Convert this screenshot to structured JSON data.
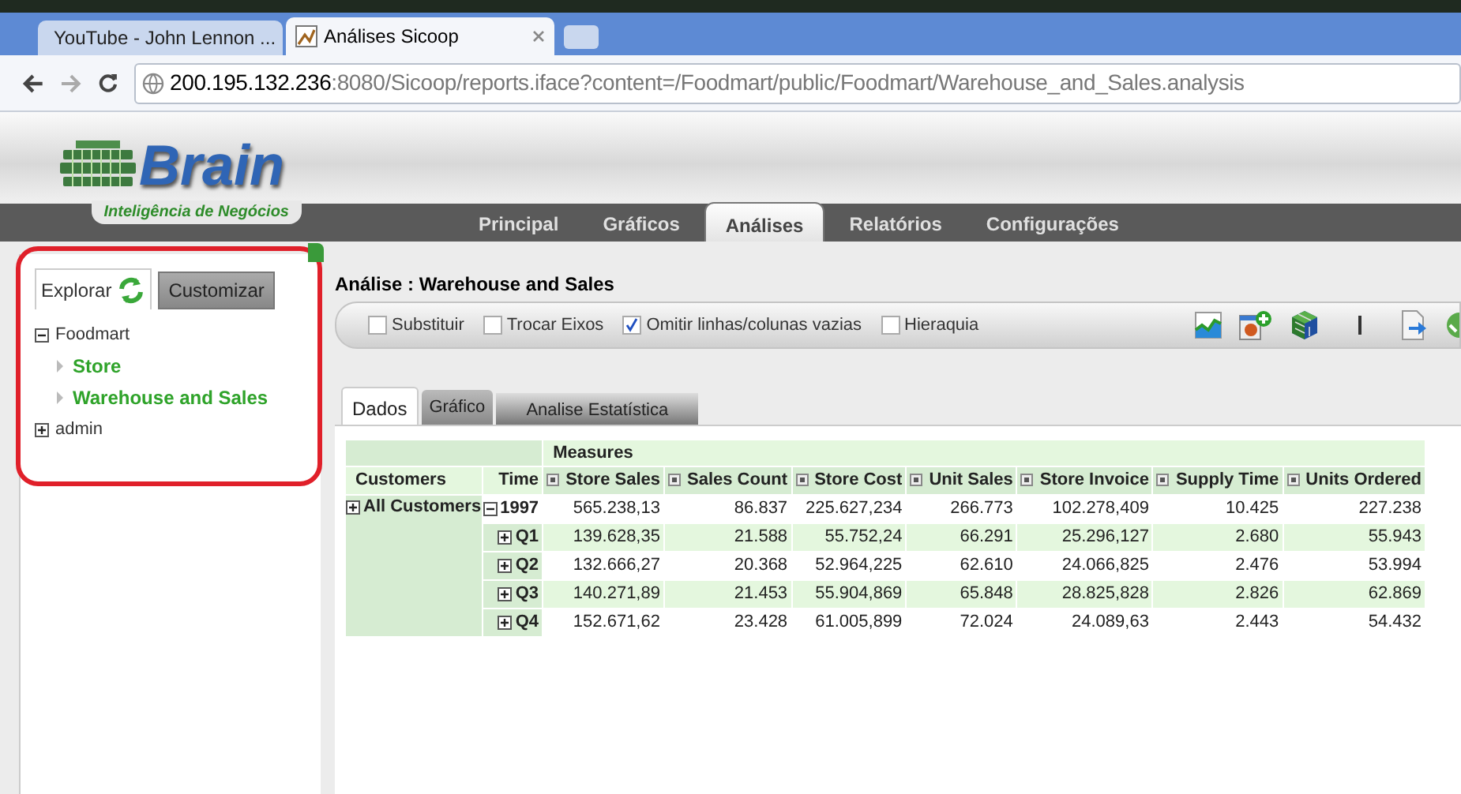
{
  "browser_tabs": [
    {
      "title": "YouTube - John Lennon ...",
      "selected": false,
      "kind": "video"
    },
    {
      "title": "Análises Sicoop",
      "selected": true,
      "kind": "app"
    }
  ],
  "address": {
    "host": "200.195.132.236",
    "rest": ":8080/Sicoop/reports.iface?content=/Foodmart/public/Foodmart/Warehouse_and_Sales.analysis"
  },
  "logo": {
    "name": "Brain",
    "tagline": "Inteligência de Negócios"
  },
  "nav_tabs": [
    {
      "label": "Principal",
      "selected": false
    },
    {
      "label": "Gráficos",
      "selected": false
    },
    {
      "label": "Análises",
      "selected": true
    },
    {
      "label": "Relatórios",
      "selected": false
    },
    {
      "label": "Configurações",
      "selected": false
    }
  ],
  "sidebar": {
    "tabs": [
      {
        "label": "Explorar",
        "selected": true
      },
      {
        "label": "Customizar",
        "selected": false
      }
    ],
    "tree": [
      {
        "label": "Foodmart",
        "expanded": true,
        "children": [
          {
            "label": "Store"
          },
          {
            "label": "Warehouse and Sales"
          }
        ]
      },
      {
        "label": "admin",
        "expanded": false
      }
    ]
  },
  "title": "Análise : Warehouse and Sales",
  "options": [
    {
      "label": "Substituir",
      "checked": false
    },
    {
      "label": "Trocar Eixos",
      "checked": false
    },
    {
      "label": "Omitir linhas/colunas vazias",
      "checked": true
    },
    {
      "label": "Hieraquia",
      "checked": false
    }
  ],
  "view_tabs": [
    {
      "label": "Dados",
      "selected": true
    },
    {
      "label": "Gráfico",
      "selected": false
    },
    {
      "label": "Analise Estatística",
      "selected": false
    }
  ],
  "table": {
    "measures_label": "Measures",
    "row_header": "Customers",
    "time_header": "Time",
    "columns": [
      "Store Sales",
      "Sales Count",
      "Store Cost",
      "Unit Sales",
      "Store Invoice",
      "Supply Time",
      "Units Ordered"
    ],
    "customer": {
      "label": "All Customers",
      "expanded": false
    },
    "rows": [
      {
        "time": "1997",
        "expanded": true,
        "values": [
          "565.238,13",
          "86.837",
          "225.627,234",
          "266.773",
          "102.278,409",
          "10.425",
          "227.238"
        ]
      },
      {
        "time": "Q1",
        "expanded": false,
        "values": [
          "139.628,35",
          "21.588",
          "55.752,24",
          "66.291",
          "25.296,127",
          "2.680",
          "55.943"
        ]
      },
      {
        "time": "Q2",
        "expanded": false,
        "values": [
          "132.666,27",
          "20.368",
          "52.964,225",
          "62.610",
          "24.066,825",
          "2.476",
          "53.994"
        ]
      },
      {
        "time": "Q3",
        "expanded": false,
        "values": [
          "140.271,89",
          "21.453",
          "55.904,869",
          "65.848",
          "28.825,828",
          "2.826",
          "62.869"
        ]
      },
      {
        "time": "Q4",
        "expanded": false,
        "values": [
          "152.671,62",
          "23.428",
          "61.005,899",
          "72.024",
          "24.089,63",
          "2.443",
          "54.432"
        ]
      }
    ]
  }
}
